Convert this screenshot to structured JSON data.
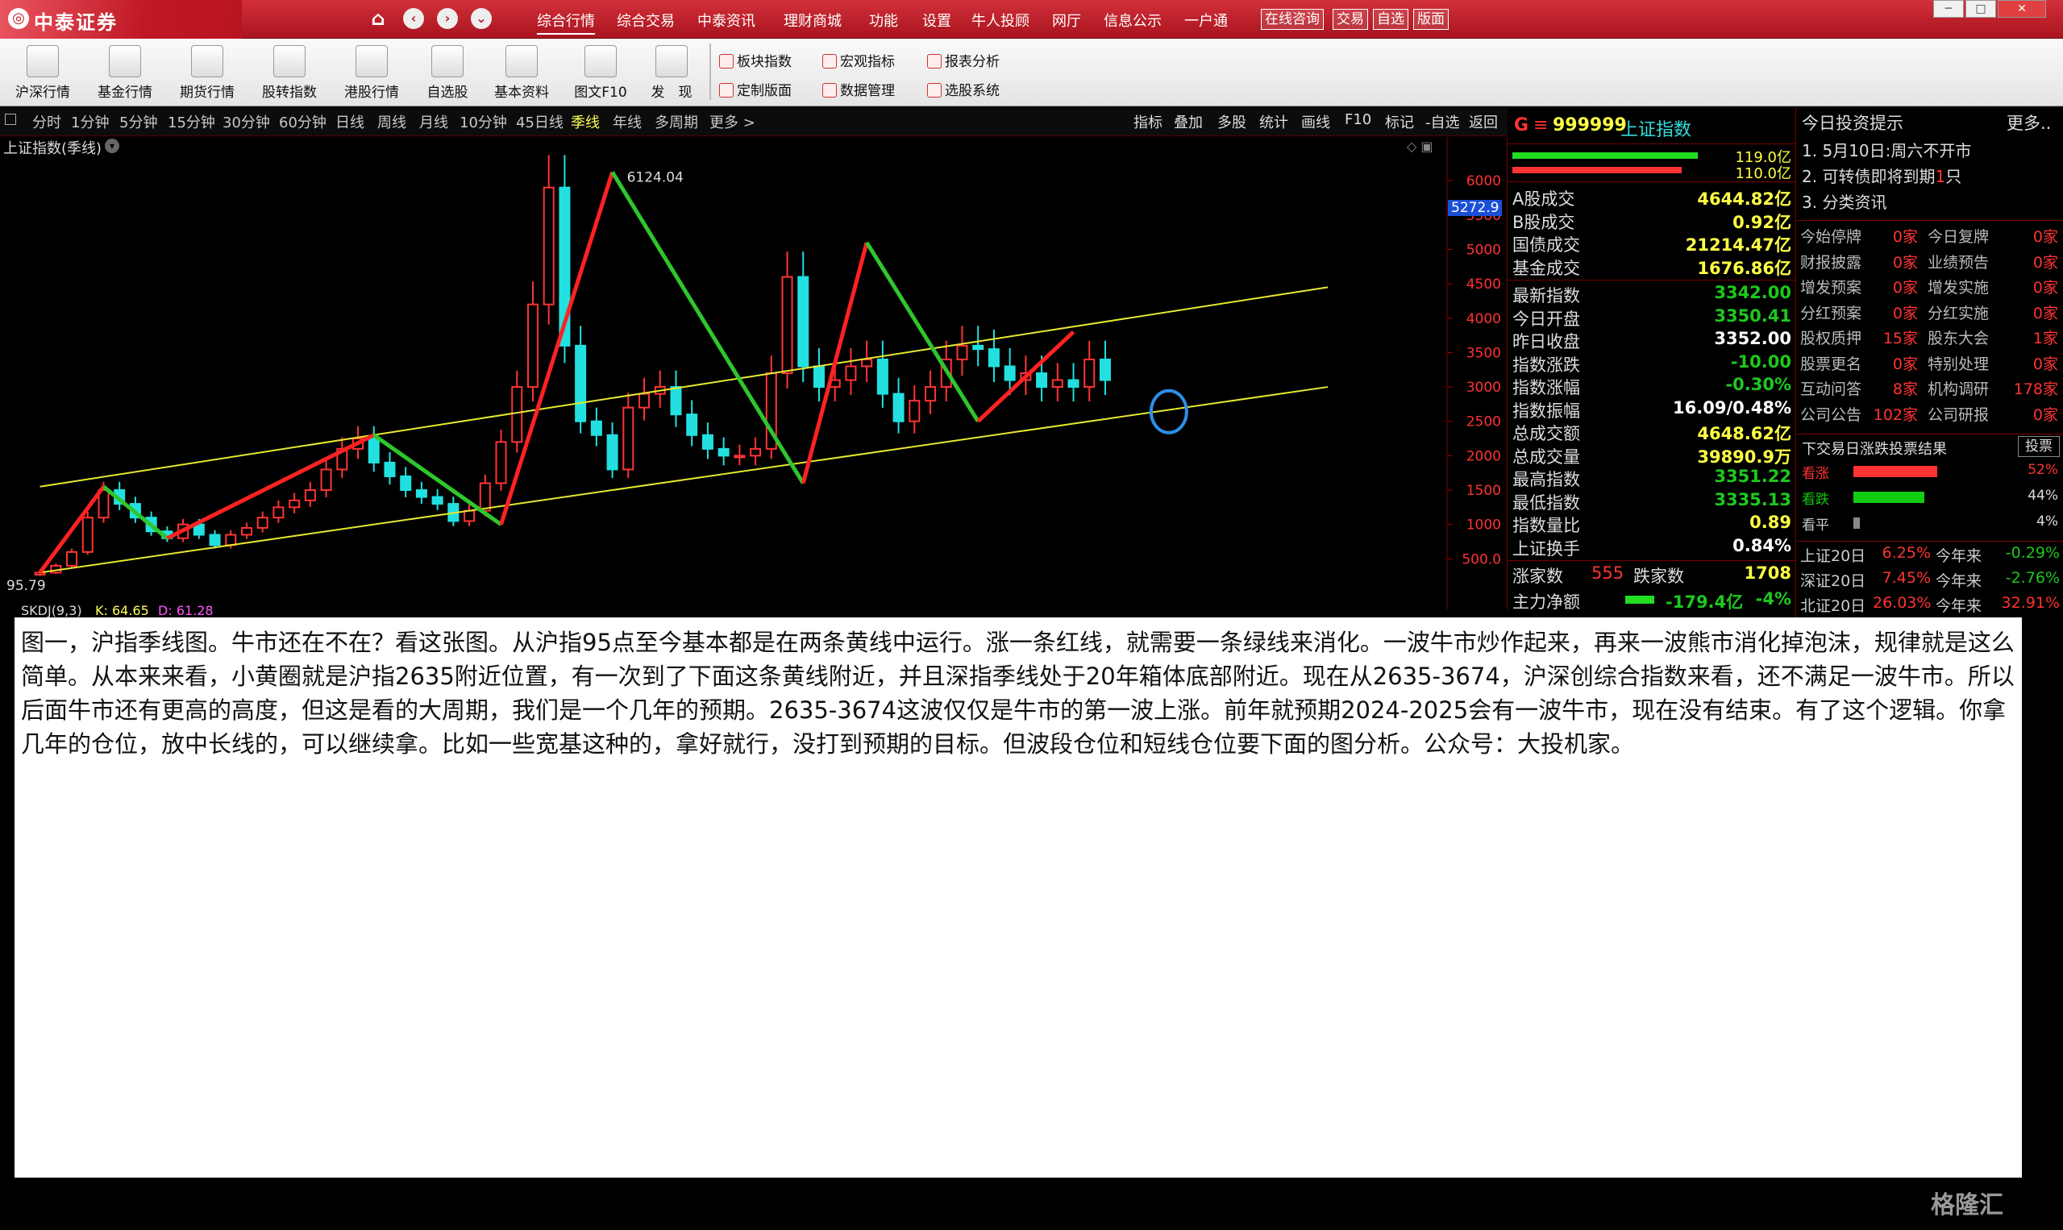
{
  "titlebar": {
    "logo": "中泰证券",
    "menu": [
      "综合行情",
      "综合交易",
      "中泰资讯",
      "理财商城",
      "功能",
      "设置",
      "牛人投顾",
      "网厅",
      "信息公示",
      "一户通"
    ],
    "boxed": [
      "在线咨询",
      "交易",
      "自选",
      "版面"
    ]
  },
  "toolbar": {
    "big": [
      "沪深行情",
      "基金行情",
      "期货行情",
      "股转指数",
      "港股行情",
      "自选股",
      "基本资料",
      "图文F10",
      "发　现"
    ],
    "small": [
      "板块指数",
      "宏观指标",
      "报表分析",
      "定制版面",
      "数据管理",
      "选股系统"
    ]
  },
  "periodbar": {
    "periods": [
      "分时",
      "1分钟",
      "5分钟",
      "15分钟",
      "30分钟",
      "60分钟",
      "日线",
      "周线",
      "月线",
      "10分钟",
      "45日线",
      "季线",
      "年线",
      "多周期",
      "更多 >"
    ],
    "active": "季线",
    "tools": [
      "指标",
      "叠加",
      "多股",
      "统计",
      "画线",
      "F10",
      "标记",
      "-自选",
      "返回"
    ]
  },
  "chart": {
    "title": "上证指数(季线)",
    "max_label": "6124.04",
    "min_label": "95.79",
    "current_price": "5272.9",
    "kdj": [
      "SKDJ(9,3)",
      "K: 64.65",
      "D: 61.28"
    ],
    "colors": {
      "up": "#ff3333",
      "down": "#22e0e0",
      "trend_up": "#ff2222",
      "trend_down": "#2ec62e",
      "channel": "#e8e830",
      "circle": "#2d8fe8"
    }
  },
  "chart_data": {
    "type": "candlestick",
    "title": "上证指数(季线)",
    "ylim": [
      0,
      6400
    ],
    "y_ticks": [
      500,
      1000,
      1500,
      2000,
      2500,
      3000,
      3500,
      4000,
      4500,
      5000,
      5500,
      6000
    ],
    "y_tick_labels": [
      "500.0",
      "1000",
      "1500",
      "2000",
      "2500",
      "3000",
      "3500",
      "4000",
      "4500",
      "5000",
      "5500",
      "6000"
    ],
    "annotations": [
      "6124.04",
      "95.79"
    ],
    "series": [
      {
        "values": [
          300,
          400,
          600,
          1100,
          1500,
          1300,
          1100,
          900,
          800,
          1000,
          850,
          700,
          850,
          950,
          1100,
          1250,
          1350,
          1500,
          1800,
          2100,
          2250,
          1900,
          1700,
          1500,
          1400,
          1300,
          1050,
          1200,
          1600,
          2200,
          3000,
          4200,
          5900,
          3600,
          2500,
          2300,
          1800,
          2700,
          2900,
          3000,
          2600,
          2300,
          2100,
          2000,
          2000,
          2100,
          3200,
          4600,
          3300,
          3000,
          3100,
          3300,
          3400,
          2900,
          2500,
          2800,
          3000,
          3400,
          3600,
          3550,
          3300,
          3100,
          3200,
          3000,
          3100,
          3000,
          3400,
          3100
        ]
      }
    ],
    "trend_lines": [
      {
        "type": "up",
        "from": [
          1,
          300
        ],
        "to": [
          5,
          1550
        ]
      },
      {
        "type": "down",
        "from": [
          5,
          1550
        ],
        "to": [
          9,
          800
        ]
      },
      {
        "type": "up",
        "from": [
          9,
          800
        ],
        "to": [
          22,
          2300
        ]
      },
      {
        "type": "down",
        "from": [
          22,
          2300
        ],
        "to": [
          30,
          1000
        ]
      },
      {
        "type": "up",
        "from": [
          30,
          1000
        ],
        "to": [
          37,
          6124
        ]
      },
      {
        "type": "down",
        "from": [
          37,
          6124
        ],
        "to": [
          49,
          1600
        ]
      },
      {
        "type": "up",
        "from": [
          49,
          1600
        ],
        "to": [
          53,
          5100
        ]
      },
      {
        "type": "down",
        "from": [
          53,
          5100
        ],
        "to": [
          60,
          2500
        ]
      },
      {
        "type": "up",
        "from": [
          60,
          2500
        ],
        "to": [
          66,
          3800
        ]
      }
    ],
    "channel_lines": [
      {
        "from": [
          1,
          1550
        ],
        "to": [
          82,
          4450
        ]
      },
      {
        "from": [
          1,
          300
        ],
        "to": [
          82,
          3000
        ]
      }
    ],
    "marker_circle": [
      72,
      2640
    ]
  },
  "info": {
    "code": "999999",
    "name": "上证指数",
    "bar_values": [
      "119.0亿",
      "110.0亿"
    ],
    "rows1": [
      {
        "label": "A股成交",
        "value": "4644.82亿",
        "color": "yellow"
      },
      {
        "label": "B股成交",
        "value": "0.92亿",
        "color": "yellow"
      },
      {
        "label": "国债成交",
        "value": "21214.47亿",
        "color": "yellow"
      },
      {
        "label": "基金成交",
        "value": "1676.86亿",
        "color": "yellow"
      }
    ],
    "rows2": [
      {
        "label": "最新指数",
        "value": "3342.00",
        "color": "green"
      },
      {
        "label": "今日开盘",
        "value": "3350.41",
        "color": "green"
      },
      {
        "label": "昨日收盘",
        "value": "3352.00",
        "color": "white"
      },
      {
        "label": "指数涨跌",
        "value": "-10.00",
        "color": "green"
      },
      {
        "label": "指数涨幅",
        "value": "-0.30%",
        "color": "green"
      },
      {
        "label": "指数振幅",
        "value": "16.09/0.48%",
        "color": "white"
      },
      {
        "label": "总成交额",
        "value": "4648.62亿",
        "color": "yellow"
      },
      {
        "label": "总成交量",
        "value": "39890.9万",
        "color": "yellow"
      },
      {
        "label": "最高指数",
        "value": "3351.22",
        "color": "green"
      },
      {
        "label": "最低指数",
        "value": "3335.13",
        "color": "green"
      },
      {
        "label": "指数量比",
        "value": "0.89",
        "color": "yellow"
      },
      {
        "label": "上证换手",
        "value": "0.84%",
        "color": "white"
      }
    ],
    "rise_label": "涨家数",
    "rise_value": "555",
    "fall_label": "跌家数",
    "fall_value": "1708",
    "flow_label": "主力净额",
    "flow_value": "-179.4亿",
    "flow_pct": "-4%"
  },
  "tips": {
    "title": "今日投资提示",
    "more": "更多..",
    "items": [
      "1. 5月10日:周六不开市",
      "2. 可转债即将到期",
      "3. 分类资讯"
    ],
    "item2_count": "1",
    "item2_suffix": "只",
    "stats": [
      [
        "今始停牌",
        "0家",
        "今日复牌",
        "0家"
      ],
      [
        "财报披露",
        "0家",
        "业绩预告",
        "0家"
      ],
      [
        "增发预案",
        "0家",
        "增发实施",
        "0家"
      ],
      [
        "分红预案",
        "0家",
        "分红实施",
        "0家"
      ],
      [
        "股权质押",
        "15家",
        "股东大会",
        "1家"
      ],
      [
        "股票更名",
        "0家",
        "特别处理",
        "0家"
      ],
      [
        "互动问答",
        "8家",
        "机构调研",
        "178家"
      ],
      [
        "公司公告",
        "102家",
        "公司研报",
        "0家"
      ]
    ],
    "vote_title": "下交易日涨跌投票结果",
    "vote_btn": "投票",
    "votes": [
      {
        "label": "看涨",
        "pct": "52%",
        "frac": 0.52,
        "color": "#ff3333"
      },
      {
        "label": "看跌",
        "pct": "44%",
        "frac": 0.44,
        "color": "#11cc11"
      },
      {
        "label": "看平",
        "pct": "4%",
        "frac": 0.04,
        "color": "#888888"
      }
    ],
    "perf": [
      [
        "上证20日",
        "6.25%",
        "今年来",
        "-0.29%"
      ],
      [
        "深证20日",
        "7.45%",
        "今年来",
        "-2.76%"
      ],
      [
        "北证20日",
        "26.03%",
        "今年来",
        "32.91%"
      ]
    ]
  },
  "annotation": {
    "text": "图一，沪指季线图。牛市还在不在？看这张图。从沪指95点至今基本都是在两条黄线中运行。涨一条红线，就需要一条绿线来消化。一波牛市炒作起来，再来一波熊市消化掉泡沫，规律就是这么简单。从本来来看，小黄圈就是沪指2635附近位置，有一次到了下面这条黄线附近，并且深指季线处于20年箱体底部附近。现在从2635-3674，沪深创综合指数来看，还不满足一波牛市。所以后面牛市还有更高的高度，但这是看的大周期，我们是一个几年的预期。2635-3674这波仅仅是牛市的第一波上涨。前年就预期2024-2025会有一波牛市，现在没有结束。有了这个逻辑。你拿几年的仓位，放中长线的，可以继续拿。比如一些宽基这种的，拿好就行，没打到预期的目标。但波段仓位和短线仓位要下面的图分析。公众号：大投机家。"
  },
  "watermark": "格隆汇"
}
